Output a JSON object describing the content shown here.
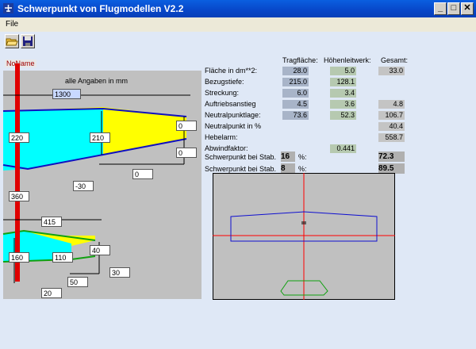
{
  "window": {
    "title": "Schwerpunkt von Flugmodellen V2.2"
  },
  "menu": {
    "file": "File"
  },
  "diagram": {
    "model_name": "NoName",
    "units_note": "alle Angaben in mm",
    "wing": {
      "span": "1300",
      "root_chord": "220",
      "mid_chord": "210",
      "tip_right_top": "0",
      "tip_right_bottom": "0",
      "sweep": "0",
      "dihedral_offset": "-30",
      "fuselage_pos": "360"
    },
    "tail": {
      "span": "415",
      "root_chord": "160",
      "mid_chord": "110",
      "tip_chord": "40",
      "tip_offset": "30",
      "sweep": "50",
      "lower": "20"
    }
  },
  "table": {
    "headers": {
      "wing": "Tragfläche:",
      "tail": "Höhenleitwerk:",
      "total": "Gesamt:"
    },
    "rows": [
      {
        "label": "Fläche in dm**2:",
        "wing": "28.0",
        "tail": "5.0",
        "total": "33.0"
      },
      {
        "label": "Bezugstiefe:",
        "wing": "215.0",
        "tail": "128.1",
        "total": ""
      },
      {
        "label": "Streckung:",
        "wing": "6.0",
        "tail": "3.4",
        "total": ""
      },
      {
        "label": "Auftriebsanstieg",
        "wing": "4.5",
        "tail": "3.6",
        "total": "4.8"
      },
      {
        "label": "Neutralpunktlage:",
        "wing": "73.6",
        "tail": "52.3",
        "total": "106.7"
      },
      {
        "label": "Neutralpunkt in %",
        "wing": "",
        "tail": "",
        "total": "40.4"
      },
      {
        "label": "Hebelarm:",
        "wing": "",
        "tail": "",
        "total": "558.7"
      },
      {
        "label": "Abwindfaktor:",
        "wing": "",
        "tail": "0.441",
        "total": ""
      }
    ],
    "cg": [
      {
        "label": "Schwerpunkt bei Stab.",
        "stability": "16",
        "unit": "%:",
        "value": "72.3"
      },
      {
        "label": "Schwerpunkt bei Stab.",
        "stability": "8",
        "unit": "%:",
        "value": "89.5"
      }
    ]
  },
  "colors": {
    "titlebar": "#0846c8",
    "fuselage": "#e00000",
    "wing_fill": "#00ffff",
    "wing_edge": "#1010c0",
    "tail_edge": "#10a010",
    "planform_yellow": "#ffff00",
    "preview_bg": "#c0c0c0"
  }
}
